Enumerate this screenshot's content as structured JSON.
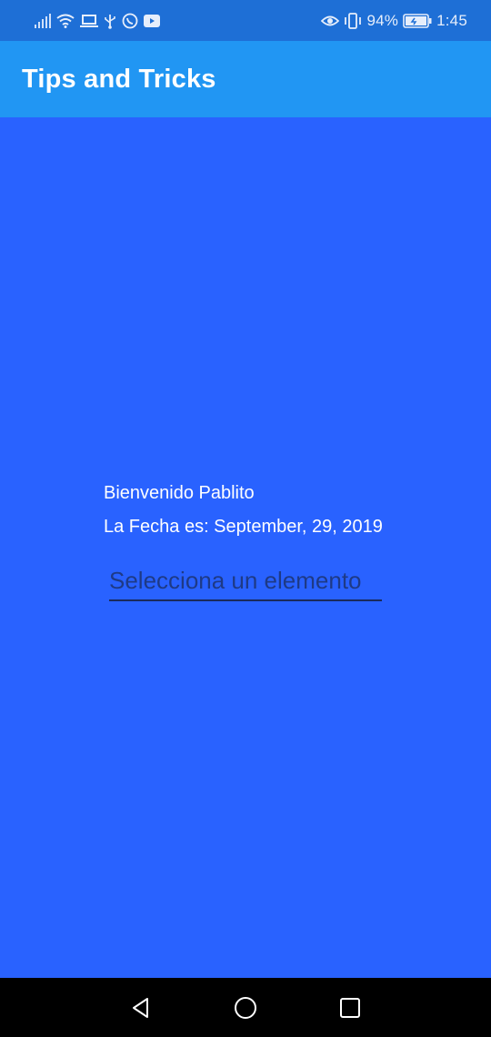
{
  "status_bar": {
    "battery_percent": "94%",
    "time": "1:45",
    "icons_left": [
      "signal-icon",
      "wifi-icon",
      "laptop-icon",
      "usb-icon",
      "whatsapp-icon",
      "youtube-icon"
    ],
    "icons_right": [
      "eye-icon",
      "vibrate-icon",
      "battery-icon"
    ]
  },
  "app_bar": {
    "title": "Tips and Tricks"
  },
  "main": {
    "greeting": "Bienvenido Pablito",
    "date_text": "La Fecha es: September, 29, 2019",
    "dropdown": {
      "hint": "Selecciona un elemento"
    }
  },
  "nav_bar": {
    "buttons": [
      "back",
      "home",
      "recents"
    ]
  },
  "colors": {
    "status_bar_bg": "#1e6fd6",
    "app_bar_bg": "#2196f3",
    "content_bg": "#2962ff",
    "text": "#ffffff",
    "hint_text": "#1e3a86",
    "nav_bar_bg": "#000000"
  }
}
